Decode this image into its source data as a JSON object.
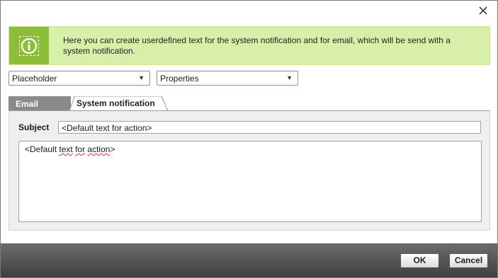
{
  "info": {
    "text": "Here you can create userdefined text for the system notification and for email, which will be send with a system notification.",
    "icon": "info-icon"
  },
  "selects": {
    "placeholder": "Placeholder",
    "properties": "Properties"
  },
  "tabs": [
    {
      "label": "Email",
      "active": true
    },
    {
      "label": "System notification",
      "active": false
    }
  ],
  "form": {
    "subject_label": "Subject",
    "subject_value": "<Default text for action>",
    "body_parts": [
      "<Default ",
      "text",
      " ",
      "for",
      " ",
      "action",
      ">"
    ]
  },
  "buttons": {
    "ok": "OK",
    "cancel": "Cancel"
  },
  "colors": {
    "info_bg": "#d8efaa",
    "info_icon_bg": "#8dbe3a",
    "active_tab": "#8a8a8a",
    "footer": "#505050"
  }
}
